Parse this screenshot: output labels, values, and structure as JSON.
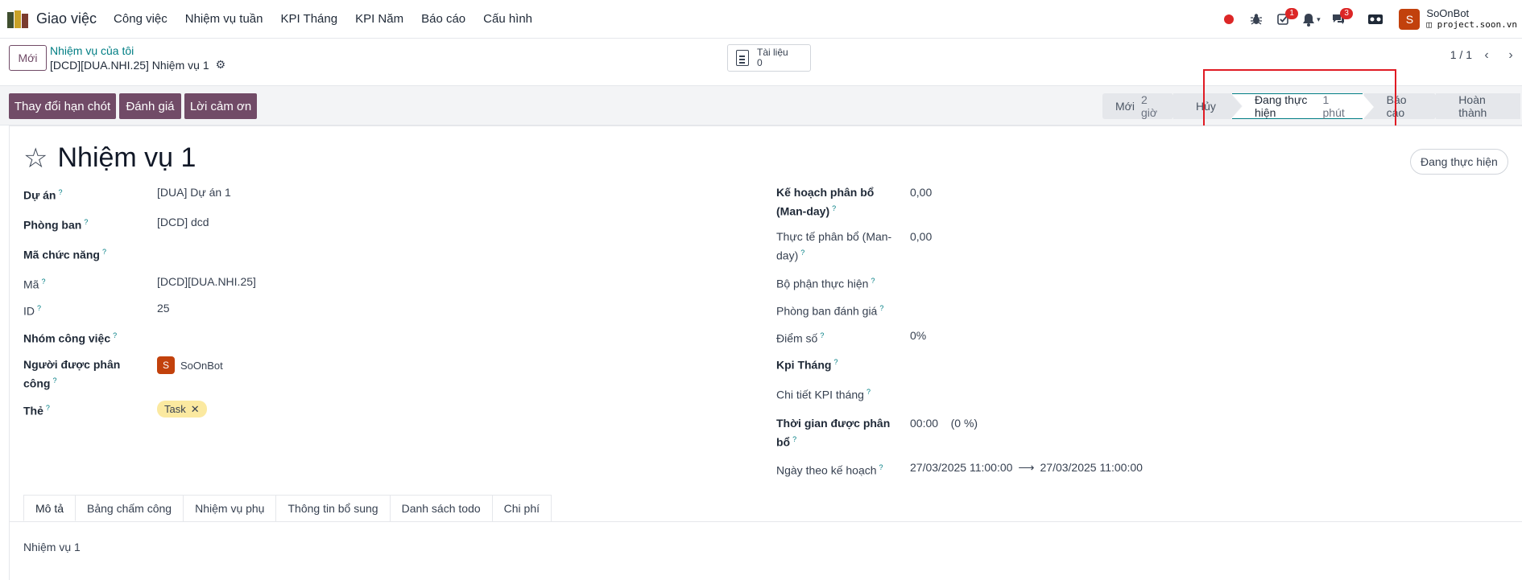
{
  "navbar": {
    "app_name": "Giao việc",
    "menu": [
      "Công việc",
      "Nhiệm vụ tuần",
      "KPI Tháng",
      "KPI Năm",
      "Báo cáo",
      "Cấu hình"
    ],
    "activity_badge": "1",
    "messages_badge": "3",
    "user_initial": "S",
    "user_name": "SoOnBot",
    "database": "project.soon.vn"
  },
  "control_panel": {
    "new_button": "Mới",
    "breadcrumb_parent": "Nhiệm vụ của tôi",
    "breadcrumb_current": "[DCD][DUA.NHI.25] Nhiệm vụ 1",
    "documents_label": "Tài liệu",
    "documents_count": "0",
    "pager": "1 / 1"
  },
  "statusbar": {
    "actions": [
      "Thay đổi hạn chót",
      "Đánh giá",
      "Lời cảm ơn"
    ],
    "stages": [
      {
        "name": "Mới",
        "count": "2 giờ"
      },
      {
        "name": "Hủy",
        "count": ""
      },
      {
        "name": "Đang thực hiện",
        "count": "1 phút"
      },
      {
        "name": "Báo cáo",
        "count": ""
      },
      {
        "name": "Hoàn thành",
        "count": ""
      }
    ],
    "active_stage": "Đang thực hiện"
  },
  "form": {
    "title": "Nhiệm vụ 1",
    "status_pill": "Đang thực hiện",
    "left": {
      "project_label": "Dự án",
      "project_value": "[DUA] Dự án 1",
      "dept_label": "Phòng ban",
      "dept_value": "[DCD] dcd",
      "function_code_label": "Mã chức năng",
      "code_label": "Mã",
      "code_value": "[DCD][DUA.NHI.25]",
      "id_label": "ID",
      "id_value": "25",
      "group_label": "Nhóm công việc",
      "assignee_label_1": "Người được phân",
      "assignee_label_2": "công",
      "assignee_value": "SoOnBot",
      "assignee_initial": "S",
      "tags_label": "Thẻ",
      "tag_value": "Task"
    },
    "right": {
      "plan_label_1": "Kế hoạch phân bổ",
      "plan_label_2": "(Man-day)",
      "plan_value": "0,00",
      "actual_label_1": "Thực tế phân bổ (Man-",
      "actual_label_2": "day)",
      "actual_value": "0,00",
      "exec_unit_label": "Bộ phận thực hiện",
      "eval_dept_label": "Phòng ban đánh giá",
      "score_label": "Điểm số",
      "score_value": "0%",
      "kpi_month_label": "Kpi Tháng",
      "kpi_detail_label": "Chi tiết KPI tháng",
      "time_label_1": "Thời gian được phân",
      "time_label_2": "bổ",
      "time_value": "00:00",
      "time_percent": "(0 %)",
      "plan_date_label": "Ngày theo kế hoạch",
      "date_start": "27/03/2025 11:00:00",
      "date_end": "27/03/2025 11:00:00"
    },
    "tabs": [
      "Mô tả",
      "Bảng chấm công",
      "Nhiệm vụ phụ",
      "Thông tin bổ sung",
      "Danh sách todo",
      "Chi phí"
    ],
    "description": "Nhiệm vụ 1"
  },
  "colors": {
    "primary": "#714b67",
    "accent": "#017e84",
    "highlight_box": "#e01b24"
  }
}
